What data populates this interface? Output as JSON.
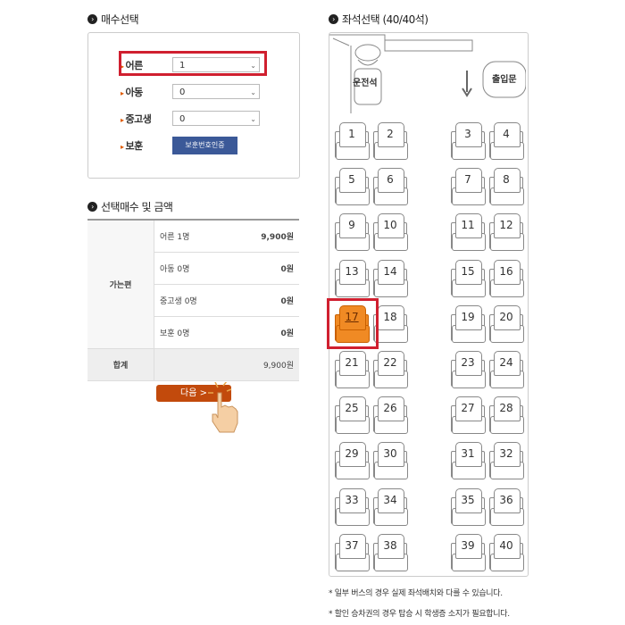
{
  "ticket": {
    "title": "매수선택",
    "rows": [
      {
        "label": "어른",
        "value": "1"
      },
      {
        "label": "아동",
        "value": "0"
      },
      {
        "label": "중고생",
        "value": "0"
      }
    ],
    "veteran_label": "보훈",
    "veteran_button": "보훈번호인증"
  },
  "summary": {
    "title": "선택매수 및 금액",
    "category": "가는편",
    "items": [
      {
        "label": "어른 1명",
        "amount": "9,900원"
      },
      {
        "label": "아동 0명",
        "amount": "0원"
      },
      {
        "label": "중고생 0명",
        "amount": "0원"
      },
      {
        "label": "보훈 0명",
        "amount": "0원"
      }
    ],
    "total_label": "합계",
    "total_amount": "9,900원"
  },
  "next_button": "다음 >",
  "seats": {
    "title": "좌석선택 (40/40석)",
    "driver_label": "운전석",
    "door_label": "출입문",
    "selected_seat": "17",
    "rows": [
      [
        "1",
        "2",
        "3",
        "4"
      ],
      [
        "5",
        "6",
        "7",
        "8"
      ],
      [
        "9",
        "10",
        "11",
        "12"
      ],
      [
        "13",
        "14",
        "15",
        "16"
      ],
      [
        "17",
        "18",
        "19",
        "20"
      ],
      [
        "21",
        "22",
        "23",
        "24"
      ],
      [
        "25",
        "26",
        "27",
        "28"
      ],
      [
        "29",
        "30",
        "31",
        "32"
      ],
      [
        "33",
        "34",
        "35",
        "36"
      ],
      [
        "37",
        "38",
        "39",
        "40"
      ]
    ]
  },
  "notes": [
    "* 일부 버스의 경우 실제 좌석배치와 다를 수 있습니다.",
    "* 할인 승차권의 경우 탑승 시 학생증 소지가 필요합니다."
  ],
  "colors": {
    "highlight": "#d01f2f",
    "selected_seat": "#f08a24",
    "next_button": "#c24a0c",
    "auth_button": "#3b5998"
  }
}
